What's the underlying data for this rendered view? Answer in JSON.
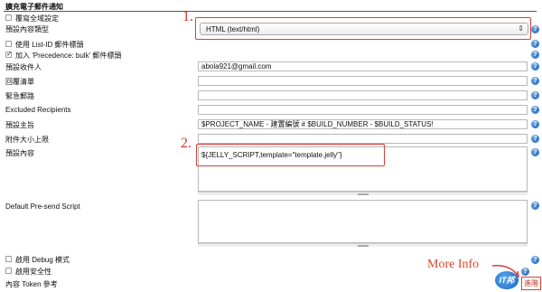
{
  "section_title": "擴充電子郵件通知",
  "override_global": "覆寫全域設定",
  "content_type": {
    "label": "預設內容類型",
    "value": "HTML (text/html)"
  },
  "use_list_id": "使用 List-ID 郵件標頭",
  "precedence_bulk": "加入 'Precedence: bulk' 郵件標頭",
  "recipients": {
    "label": "預設收件人",
    "value": "abola921@gmail.com"
  },
  "reply_to": {
    "label": "回覆清單",
    "value": ""
  },
  "emergency_reroute": {
    "label": "緊急郵路",
    "value": ""
  },
  "excluded": {
    "label": "Excluded Recipients",
    "value": ""
  },
  "subject": {
    "label": "預設主旨",
    "value": "$PROJECT_NAME - 建置編號 # $BUILD_NUMBER - $BUILD_STATUS!"
  },
  "attachment_size": {
    "label": "附件大小上限",
    "value": ""
  },
  "content": {
    "label": "預設內容",
    "value": "${JELLY_SCRIPT,template=\"template.jelly\"}"
  },
  "presend": {
    "label": "Default Pre-send Script",
    "value": ""
  },
  "debug_mode": "啟用 Debug 模式",
  "security": "啟用安全性",
  "token_ref": "內容 Token 參考",
  "annotations": {
    "one": "1.",
    "two": "2.",
    "more_info": "More  Info"
  },
  "advanced_button": "進階",
  "logo_text": "IT邦",
  "help_glyph": "?",
  "colors": {
    "annotation": "#e23b3b",
    "help_icon": "#2a6fc0",
    "logo": "#1f6fd1"
  }
}
